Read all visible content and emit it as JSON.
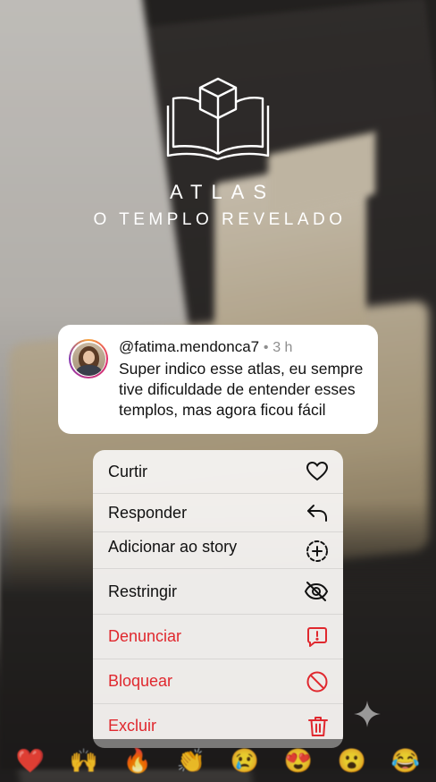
{
  "logo": {
    "brand": "ATLAS",
    "subtitle": "O TEMPLO REVELADO",
    "icon": "open-book-cube-icon"
  },
  "comment": {
    "username": "@fatima.mendonca7",
    "separator": "•",
    "time": "3 h",
    "text": "Super indico esse atlas, eu sempre tive dificuldade de entender esses templos, mas agora ficou fácil"
  },
  "menu": {
    "items": [
      {
        "label": "Curtir",
        "icon": "heart-icon",
        "color": "#111111"
      },
      {
        "label": "Responder",
        "icon": "reply-arrow-icon",
        "color": "#111111"
      },
      {
        "label": "Adicionar ao story",
        "icon": "add-story-icon",
        "color": "#111111"
      },
      {
        "label": "Restringir",
        "icon": "eye-off-icon",
        "color": "#111111"
      },
      {
        "label": "Denunciar",
        "icon": "report-icon",
        "color": "#e0282e"
      },
      {
        "label": "Bloquear",
        "icon": "block-icon",
        "color": "#e0282e"
      },
      {
        "label": "Excluir",
        "icon": "trash-icon",
        "color": "#e0282e"
      }
    ]
  },
  "reactions": [
    "❤️",
    "🙌",
    "🔥",
    "👏",
    "😢",
    "😍",
    "😮",
    "😂"
  ],
  "colors": {
    "danger": "#e0282e",
    "menu_bg": "#f4f2f0",
    "story_ring": [
      "#f7a33a",
      "#e1306c",
      "#833ab4"
    ]
  }
}
